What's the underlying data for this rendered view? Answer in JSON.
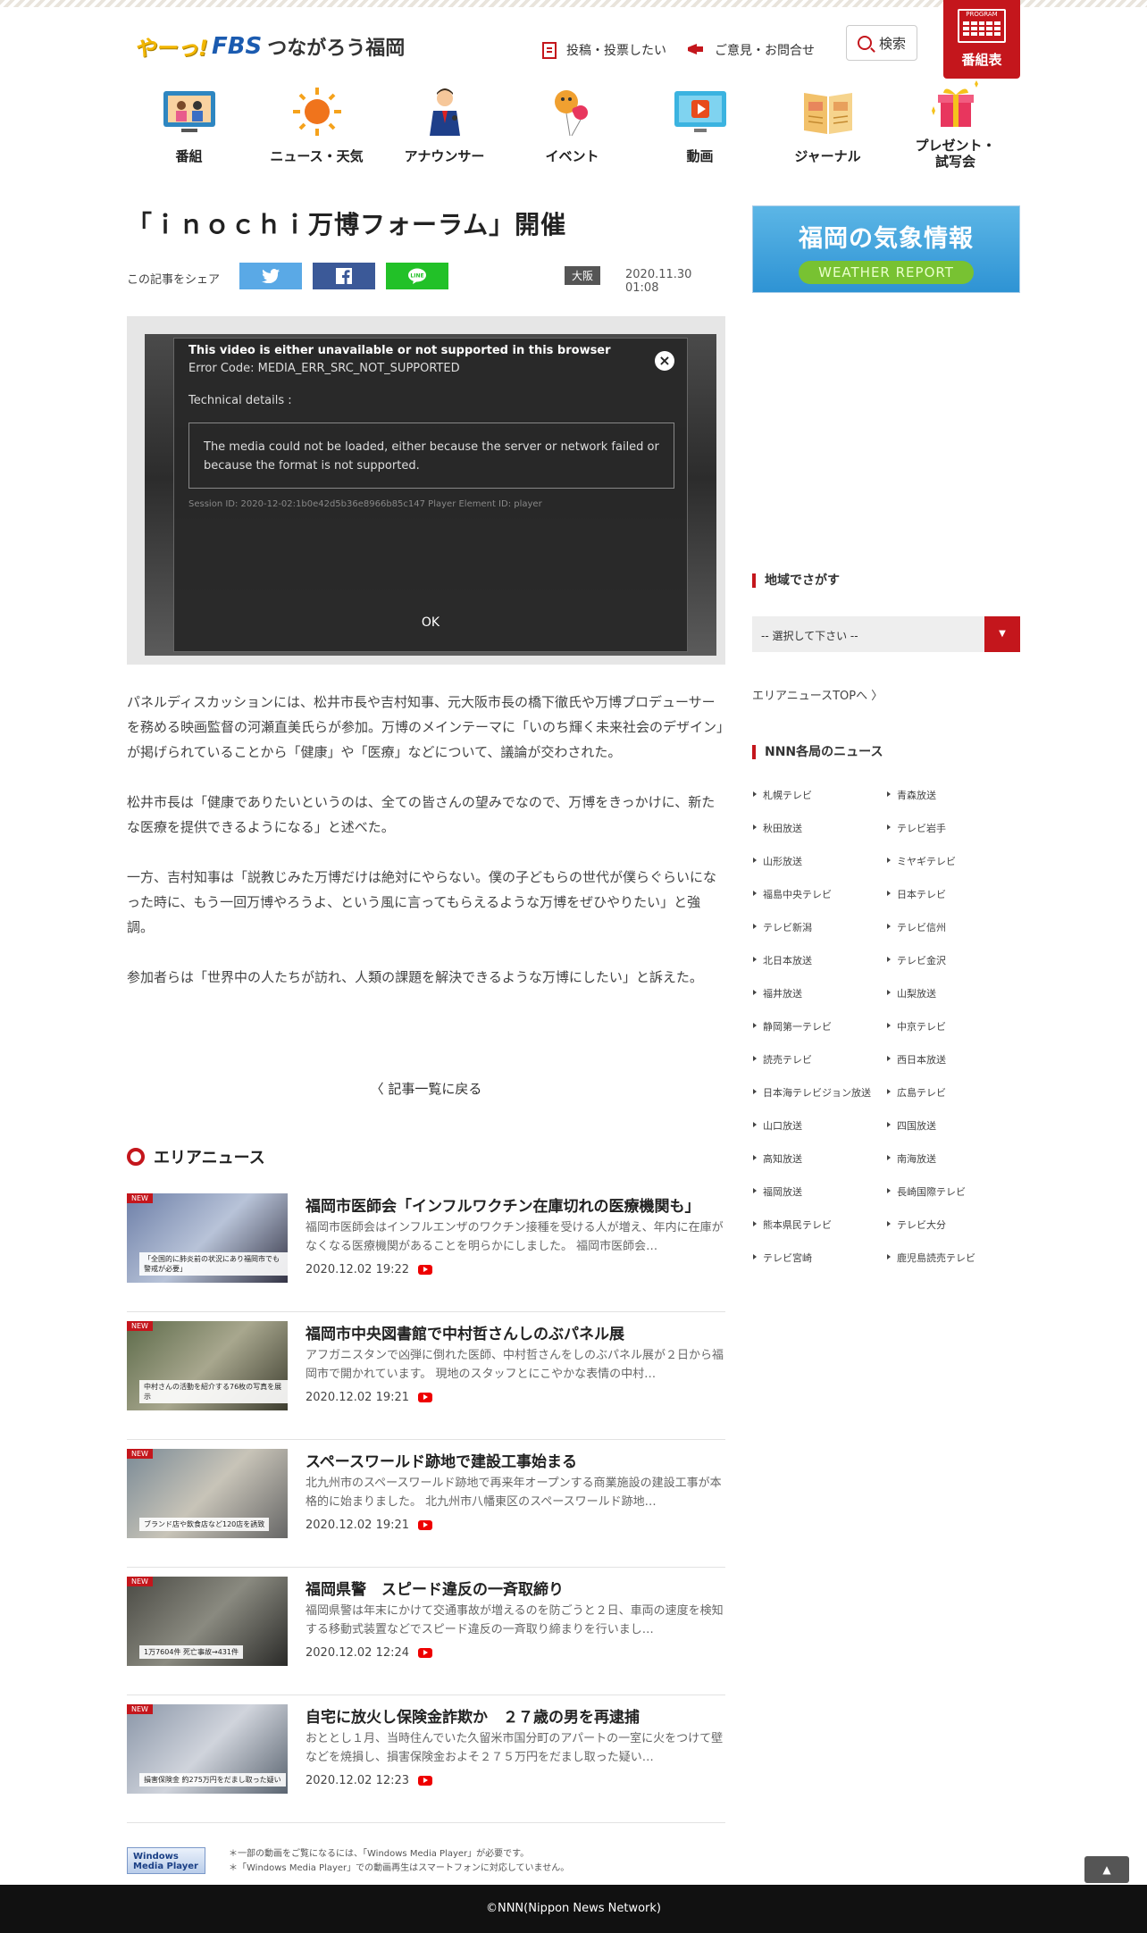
{
  "header": {
    "logo_ya": "やーっ!",
    "logo_fbs": "FBS",
    "logo_tag": "つながろう福岡",
    "post_link": "投稿・投票したい",
    "inquiry_link": "ご意見・お問合せ",
    "search_label": "検索",
    "program_tag": "PROGRAM",
    "program_label": "番組表"
  },
  "nav": [
    {
      "label": "番組",
      "icon": "tv-icon"
    },
    {
      "label": "ニュース・天気",
      "icon": "sun-icon"
    },
    {
      "label": "アナウンサー",
      "icon": "announcer-icon"
    },
    {
      "label": "イベント",
      "icon": "balloon-icon"
    },
    {
      "label": "動画",
      "icon": "monitor-play-icon"
    },
    {
      "label": "ジャーナル",
      "icon": "journal-icon"
    },
    {
      "label": "プレゼント・\n試写会",
      "icon": "gift-icon"
    }
  ],
  "article": {
    "title": "「ｉｎｏｃｈｉ万博フォーラム」開催",
    "share_label": "この記事をシェア",
    "region": "大阪",
    "date": "2020.11.30 01:08",
    "paragraphs": [
      "パネルディスカッションには、松井市長や吉村知事、元大阪市長の橋下徹氏や万博プロデューサーを務める映画監督の河瀬直美氏らが参加。万博のメインテーマに「いのち輝く未来社会のデザイン」が掲げられていることから「健康」や「医療」などについて、議論が交わされた。",
      "松井市長は「健康でありたいというのは、全ての皆さんの望みでなので、万博をきっかけに、新たな医療を提供できるようになる」と述べた。",
      "一方、吉村知事は「説教じみた万博だけは絶対にやらない。僕の子どもらの世代が僕らぐらいになった時に、もう一回万博やろうよ、という風に言ってもらえるような万博をぜひやりたい」と強調。",
      "参加者らは「世界中の人たちが訪れ、人類の課題を解決できるような万博にしたい」と訴えた。"
    ],
    "back_link": "記事一覧に戻る"
  },
  "video_error": {
    "title": "This video is either unavailable or not supported in this browser",
    "code": "Error Code: MEDIA_ERR_SRC_NOT_SUPPORTED",
    "tech": "Technical details :",
    "message": "The media could not be loaded, either because the server or network failed or because the format is not supported.",
    "session": "Session ID: 2020-12-02:1b0e42d5b36e8966b85c147 Player Element ID: player",
    "ok": "OK",
    "close": "×"
  },
  "area_news": {
    "heading": "エリアニュース",
    "new_badge": "NEW",
    "items": [
      {
        "title": "福岡市医師会「インフルワクチン在庫切れの医療機関も」",
        "desc": "福岡市医師会はインフルエンザのワクチン接種を受ける人が増え、年内に在庫がなくなる医療機関があることを明らかにしました。 福岡市医師会…",
        "date": "2020.12.02 19:22",
        "caption": "「全国的に肺炎前の状況にあり福岡市でも警戒が必要」"
      },
      {
        "title": "福岡市中央図書館で中村哲さんしのぶパネル展",
        "desc": "アフガニスタンで凶弾に倒れた医師、中村哲さんをしのぶパネル展が２日から福岡市で開かれています。 現地のスタッフとにこやかな表情の中村…",
        "date": "2020.12.02 19:21",
        "caption": "中村さんの活動を紹介する76枚の写真を展示"
      },
      {
        "title": "スペースワールド跡地で建設工事始まる",
        "desc": "北九州市のスペースワールド跡地で再来年オープンする商業施設の建設工事が本格的に始まりました。 北九州市八幡東区のスペースワールド跡地…",
        "date": "2020.12.02 19:21",
        "caption": "ブランド店や飲食店など120店を誘致"
      },
      {
        "title": "福岡県警　スピード違反の一斉取締り",
        "desc": "福岡県警は年末にかけて交通事故が増えるのを防ごうと２日、車両の速度を検知する移動式装置などでスピード違反の一斉取り締まりを行いまし…",
        "date": "2020.12.02 12:24",
        "caption": "1万7604件 死亡事故→431件"
      },
      {
        "title": "自宅に放火し保険金詐欺か　２７歳の男を再逮捕",
        "desc": "おととし１月、当時住んでいた久留米市国分町のアパートの一室に火をつけて壁などを焼損し、損害保険金およそ２７５万円をだまし取った疑い…",
        "date": "2020.12.02 12:23",
        "caption": "損害保険金 約275万円をだまし取った疑い"
      }
    ]
  },
  "wmp": {
    "logo": "Windows Media Player",
    "note1": "＊一部の動画をご覧になるには、「Windows Media Player」が必要です。",
    "note2": "＊「Windows Media Player」での動画再生はスマートフォンに対応していません。"
  },
  "sidebar": {
    "weather_title": "福岡の気象情報",
    "weather_sub": "WEATHER REPORT",
    "region_heading": "地域でさがす",
    "select_value": "-- 選択して下さい --",
    "area_top": "エリアニュースTOPへ",
    "nnn_heading": "NNN各局のニュース",
    "stations": [
      "札幌テレビ",
      "青森放送",
      "秋田放送",
      "テレビ岩手",
      "山形放送",
      "ミヤギテレビ",
      "福島中央テレビ",
      "日本テレビ",
      "テレビ新潟",
      "テレビ信州",
      "北日本放送",
      "テレビ金沢",
      "福井放送",
      "山梨放送",
      "静岡第一テレビ",
      "中京テレビ",
      "読売テレビ",
      "西日本放送",
      "日本海テレビジョン放送",
      "広島テレビ",
      "山口放送",
      "四国放送",
      "高知放送",
      "南海放送",
      "福岡放送",
      "長崎国際テレビ",
      "熊本県民テレビ",
      "テレビ大分",
      "テレビ宮崎",
      "鹿児島読売テレビ"
    ]
  },
  "footer": {
    "copyright": "©NNN(Nippon News Network)",
    "totop": "▲"
  }
}
